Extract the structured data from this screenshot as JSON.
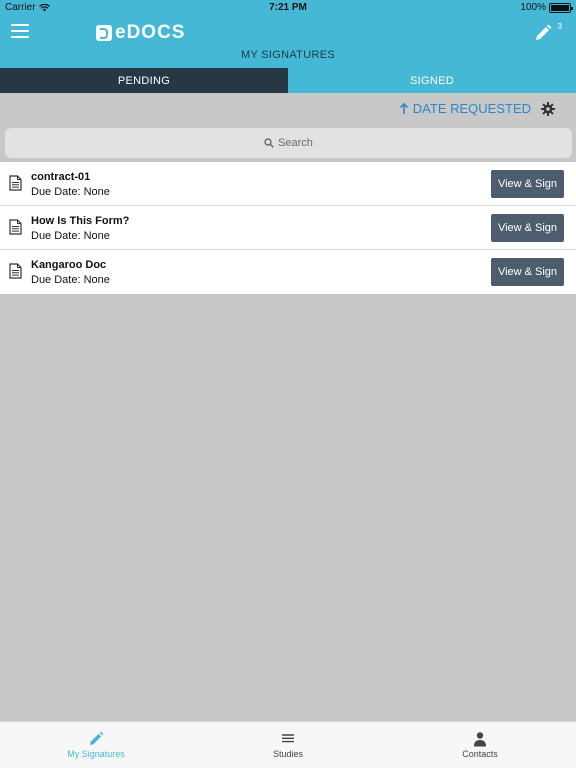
{
  "status_bar": {
    "carrier": "Carrier",
    "time": "7:21 PM",
    "battery_text": "100%",
    "battery_level": 1.0
  },
  "header": {
    "logo_text": "eDOCS",
    "page_title": "MY SIGNATURES",
    "edit_badge_count": "3",
    "brand_color": "#45b8d6"
  },
  "tabs": [
    {
      "label": "PENDING",
      "selected": true
    },
    {
      "label": "SIGNED",
      "selected": false
    }
  ],
  "sort": {
    "label": "DATE REQUESTED",
    "direction_icon": "arrow-up-icon",
    "accent_color": "#2c88c8"
  },
  "search": {
    "placeholder": "Search"
  },
  "documents": [
    {
      "title": "contract-01",
      "due": "Due Date: None",
      "action": "View & Sign"
    },
    {
      "title": "How Is This Form?",
      "due": "Due Date: None",
      "action": "View & Sign"
    },
    {
      "title": "Kangaroo Doc",
      "due": "Due Date: None",
      "action": "View & Sign"
    }
  ],
  "tab_bar": [
    {
      "label": "My Signatures",
      "icon": "pencil-icon",
      "active": true
    },
    {
      "label": "Studies",
      "icon": "list-icon",
      "active": false
    },
    {
      "label": "Contacts",
      "icon": "person-icon",
      "active": false
    }
  ]
}
